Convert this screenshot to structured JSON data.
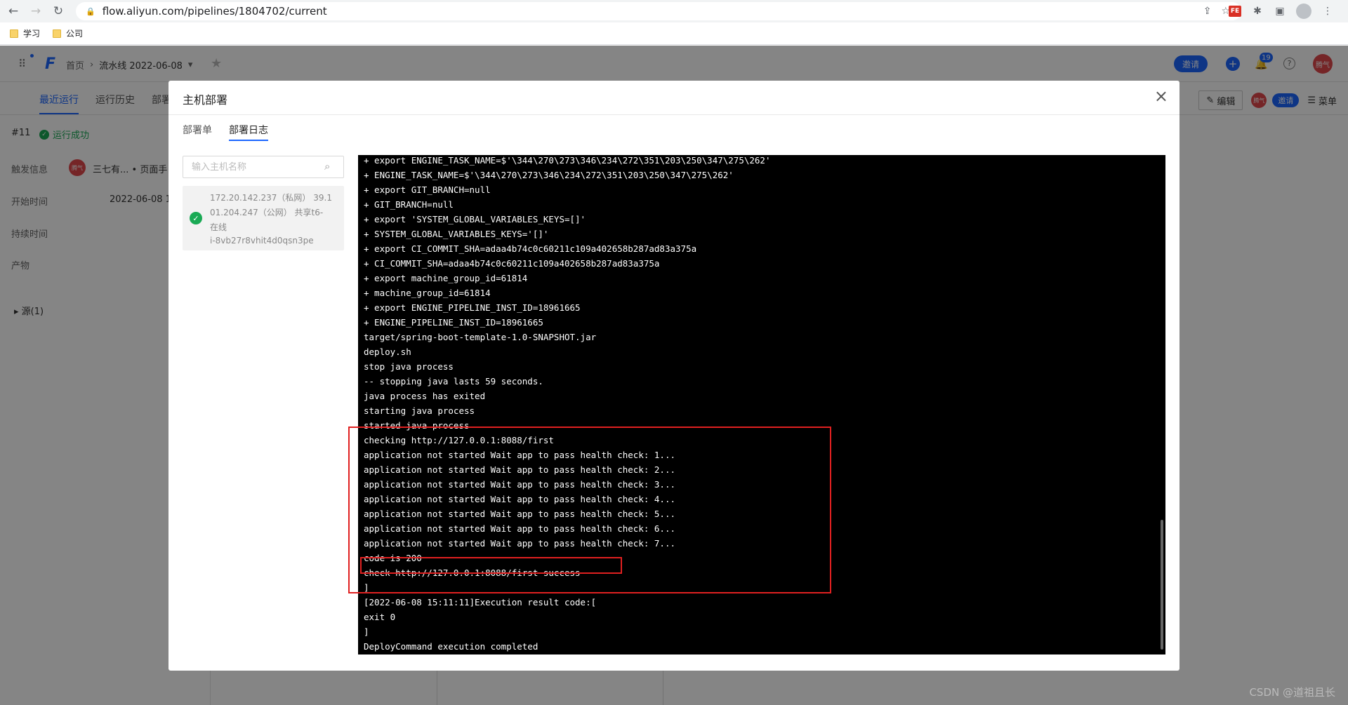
{
  "browser": {
    "url": "flow.aliyun.com/pipelines/1804702/current",
    "bookmarks": [
      "学习",
      "公司"
    ]
  },
  "app": {
    "breadcrumb_home": "首页",
    "pipeline_name": "流水线 2022-06-08",
    "invite_label": "邀请",
    "notification_count": "19",
    "user_avatar": "腾气",
    "tabs": [
      "最近运行",
      "运行历史",
      "部署"
    ],
    "edit_label": "编辑",
    "menu_label": "菜单",
    "run": {
      "id": "#11",
      "status": "运行成功",
      "trigger_label": "触发信息",
      "trigger_value": "三七有... • 页面手",
      "start_label": "开始时间",
      "start_value": "2022-06-08 1",
      "duration_label": "持续时间",
      "artifact_label": "产物",
      "source_label": "源(1)"
    }
  },
  "modal": {
    "title": "主机部署",
    "tabs": [
      "部署单",
      "部署日志"
    ],
    "active_tab": "部署日志",
    "search_placeholder": "输入主机名称",
    "host": {
      "line1": "172.20.142.237（私网） 39.1",
      "line2": "01.204.247（公网） 共享t6-",
      "line3": "在线",
      "line4": "i-8vb27r8vhit4d0qsn3pe"
    },
    "log_lines": [
      "+ export ENGINE_TASK_NAME=$'\\344\\270\\273\\346\\234\\272\\351\\203\\250\\347\\275\\262'",
      "+ ENGINE_TASK_NAME=$'\\344\\270\\273\\346\\234\\272\\351\\203\\250\\347\\275\\262'",
      "+ export GIT_BRANCH=null",
      "+ GIT_BRANCH=null",
      "+ export 'SYSTEM_GLOBAL_VARIABLES_KEYS=[]'",
      "+ SYSTEM_GLOBAL_VARIABLES_KEYS='[]'",
      "+ export CI_COMMIT_SHA=adaa4b74c0c60211c109a402658b287ad83a375a",
      "+ CI_COMMIT_SHA=adaa4b74c0c60211c109a402658b287ad83a375a",
      "+ export machine_group_id=61814",
      "+ machine_group_id=61814",
      "+ export ENGINE_PIPELINE_INST_ID=18961665",
      "+ ENGINE_PIPELINE_INST_ID=18961665",
      "target/spring-boot-template-1.0-SNAPSHOT.jar",
      "deploy.sh",
      "stop java process",
      "-- stopping java lasts 59 seconds.",
      "java process has exited",
      "starting java process",
      "started java process",
      "checking http://127.0.0.1:8088/first",
      "application not started Wait app to pass health check: 1...",
      "application not started Wait app to pass health check: 2...",
      "application not started Wait app to pass health check: 3...",
      "application not started Wait app to pass health check: 4...",
      "application not started Wait app to pass health check: 5...",
      "application not started Wait app to pass health check: 6...",
      "application not started Wait app to pass health check: 7...",
      "code is 200",
      "check http://127.0.0.1:8088/first success",
      "]",
      "[2022-06-08 15:11:11]Execution result code:[",
      "exit 0",
      "]",
      "DeployCommand execution completed"
    ]
  },
  "watermark": "CSDN @道祖且长",
  "colors": {
    "accent": "#1b66ff",
    "success": "#1aaa55",
    "highlight": "#e02020",
    "terminal_bg": "#000000"
  }
}
